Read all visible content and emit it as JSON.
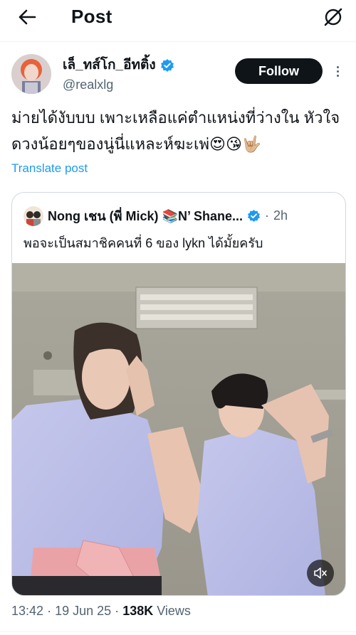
{
  "header": {
    "title": "Post",
    "back_icon": "arrow-left-icon",
    "grok_icon": "grok-icon"
  },
  "post": {
    "author": {
      "display_name": "เล็_ทส์โก_อีทติ้ง",
      "handle": "@realxlg",
      "verified": true,
      "verified_color": "#1d9bf0"
    },
    "follow_label": "Follow",
    "text": "ม่ายได้งับบบ เพาะเหลือแค่ตำแหน่งที่ว่างใน หัวใจดวงน้อยๆของนู่นี่แหละห์ฆะเพ่😍😘🤟🏼",
    "translate_label": "Translate post",
    "quote": {
      "display_name": "Nong เชน (พี่ Mick) 📚N’ Shane...",
      "verified": true,
      "time": "2h",
      "separator": "·",
      "text": "พอจะเป็นสมาชิคคนที่ 6 ของ lykn ได้มั้ยครับ",
      "media_type": "video",
      "mute_icon": "volume-mute-icon"
    },
    "meta": {
      "time": "13:42",
      "date": "19 Jun 25",
      "views_count": "138K",
      "views_label": "Views",
      "sep": "·"
    }
  },
  "colors": {
    "accent": "#1d9bf0",
    "text_primary": "#0f1419",
    "text_secondary": "#536471",
    "button_bg": "#0f1419"
  }
}
